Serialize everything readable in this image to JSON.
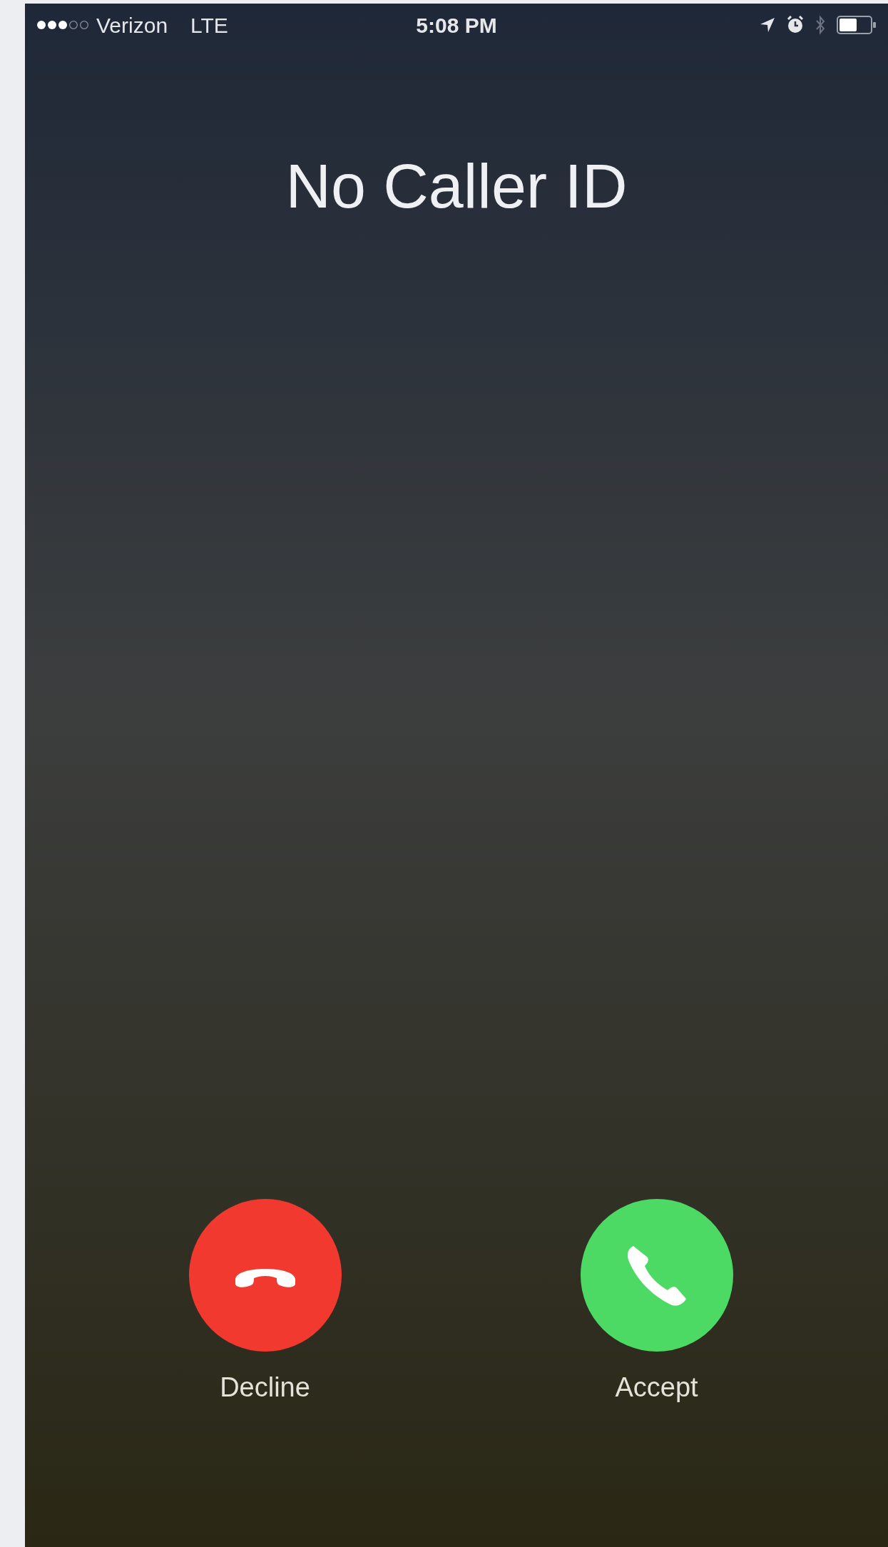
{
  "status_bar": {
    "carrier": "Verizon",
    "network": "LTE",
    "time": "5:08 PM"
  },
  "caller": {
    "name": "No Caller ID"
  },
  "actions": [
    {
      "label": "Decline",
      "kind": "decline"
    },
    {
      "label": "Accept",
      "kind": "accept"
    }
  ]
}
